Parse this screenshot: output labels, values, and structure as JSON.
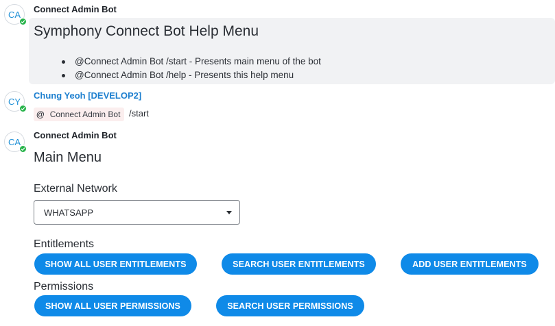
{
  "messages": [
    {
      "avatar": "CA",
      "sender": "Connect Admin Bot",
      "title": "Symphony Connect Bot Help Menu",
      "items": [
        "@Connect Admin Bot /start - Presents main menu of the bot",
        "@Connect Admin Bot /help - Presents this help menu"
      ]
    },
    {
      "avatar": "CY",
      "sender": "Chung Yeoh [DEVELOP2]",
      "mention_symbol": "@",
      "mention": "Connect Admin Bot",
      "command": "/start"
    },
    {
      "avatar": "CA",
      "sender": "Connect Admin Bot",
      "title": "Main Menu",
      "network_label": "External Network",
      "network_value": "WHATSAPP",
      "entitlements_label": "Entitlements",
      "entitlement_buttons": [
        "SHOW ALL USER ENTITLEMENTS",
        "SEARCH USER ENTITLEMENTS",
        "ADD USER ENTITLEMENTS"
      ],
      "permissions_label": "Permissions",
      "permission_buttons": [
        "SHOW ALL USER PERMISSIONS",
        "SEARCH USER PERMISSIONS"
      ]
    }
  ],
  "icons": {
    "presence": "check-icon",
    "dropdown": "chevron-down-icon",
    "mention": "at-sign-icon"
  },
  "colors": {
    "accent": "#0f8ae8",
    "user_name": "#1d7fcf",
    "presence": "#27b34a",
    "bubble": "#f1f2f4",
    "mention_bg": "#fbeeee"
  }
}
